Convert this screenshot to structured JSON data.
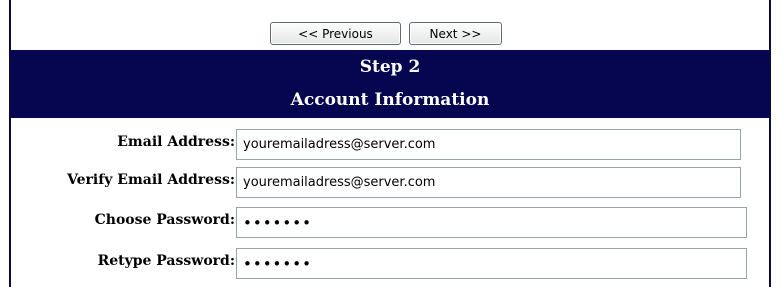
{
  "nav": {
    "previous_label": "<< Previous",
    "next_label": "Next >>"
  },
  "header": {
    "step": "Step 2",
    "section": "Account Information"
  },
  "fields": [
    {
      "label": "Email Address:",
      "value": "youremailadress@server.com",
      "type": "text"
    },
    {
      "label": "Verify Email Address:",
      "value": "youremailadress@server.com",
      "type": "text"
    },
    {
      "label": "Choose Password:",
      "value": "1234567",
      "type": "password"
    },
    {
      "label": "Retype Password:",
      "value": "1234567",
      "type": "password"
    }
  ],
  "colors": {
    "header_bg": "#050550",
    "header_text": "#ffffff",
    "border": "#0a0a40"
  }
}
